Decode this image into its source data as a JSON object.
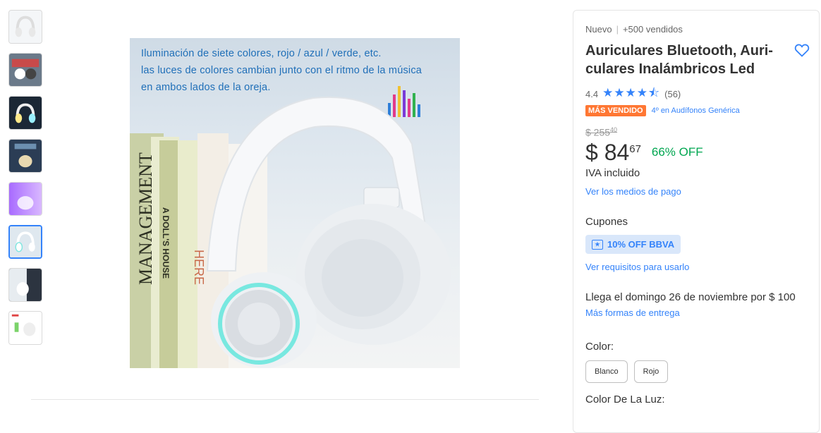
{
  "gallery": {
    "thumbnails": [
      {
        "name": "thumb-1",
        "selected": false
      },
      {
        "name": "thumb-2",
        "selected": false
      },
      {
        "name": "thumb-3",
        "selected": false
      },
      {
        "name": "thumb-4",
        "selected": false
      },
      {
        "name": "thumb-5",
        "selected": false
      },
      {
        "name": "thumb-6",
        "selected": true
      },
      {
        "name": "thumb-7",
        "selected": false
      },
      {
        "name": "thumb-8",
        "selected": false
      }
    ],
    "main_image_text": [
      "Iluminación de siete colores, rojo / azul / verde, etc.",
      "las luces de colores cambian junto con el ritmo de la música",
      "en ambos lados de la oreja."
    ],
    "book_spines": [
      "MANAGEMENT",
      "A DOLL'S HOUSE",
      "HERE"
    ]
  },
  "product": {
    "condition": "Nuevo",
    "sold": "+500 vendidos",
    "title": "Auriculares Bluetooth, Auri-culares Inalámbricos Led",
    "rating": "4.4",
    "stars": "★★★★⯪",
    "reviews": "(56)",
    "badge": "MÁS VENDIDO",
    "ranking": "4º en Audífonos Genérica",
    "old_price_int": "$ 255",
    "old_price_cents": "40",
    "price_int": "$ 84",
    "price_cents": "67",
    "discount": "66% OFF",
    "tax_note": "IVA incluido",
    "payment_link": "Ver los medios de pago",
    "coupons_label": "Cupones",
    "coupon": "10% OFF BBVA",
    "coupon_requirements_link": "Ver requisitos para usarlo",
    "delivery": "Llega el domingo 26 de noviembre por $ 100",
    "delivery_link": "Más formas de entrega",
    "color_label": "Color:",
    "colors": [
      "Blanco",
      "Rojo"
    ],
    "light_color_label": "Color De La Luz:"
  },
  "colors": {
    "accent": "#3483fa",
    "discount": "#00a650",
    "badge": "#ff7733"
  }
}
